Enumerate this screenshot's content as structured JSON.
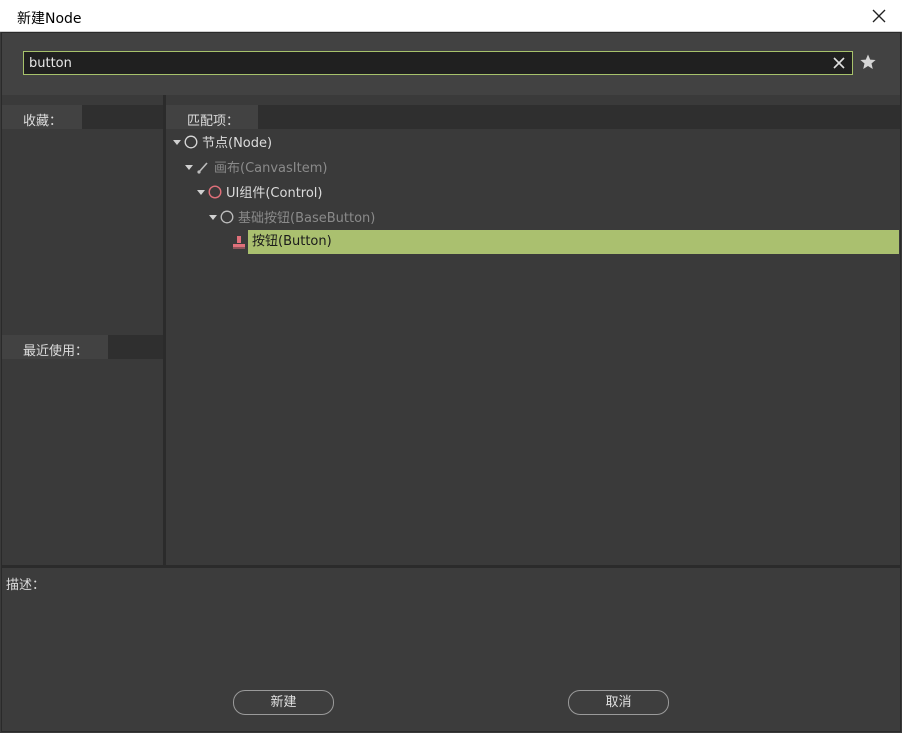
{
  "window": {
    "title": "新建Node"
  },
  "search": {
    "value": "button",
    "placeholder": ""
  },
  "favorites": {
    "tab_label": "收藏："
  },
  "recent": {
    "tab_label": "最近使用："
  },
  "matches": {
    "tab_label": "匹配项：",
    "tree": [
      {
        "label": "节点(Node)",
        "depth": 0,
        "expanded": true,
        "icon": "circle-icon",
        "style": "bright"
      },
      {
        "label": "画布(CanvasItem)",
        "depth": 1,
        "expanded": true,
        "icon": "brush-icon",
        "style": "dim"
      },
      {
        "label": "UI组件(Control)",
        "depth": 2,
        "expanded": true,
        "icon": "red-circle-icon",
        "style": "bright"
      },
      {
        "label": "基础按钮(BaseButton)",
        "depth": 3,
        "expanded": true,
        "icon": "circle-icon",
        "style": "dim"
      },
      {
        "label": "按钮(Button)",
        "depth": 4,
        "expanded": false,
        "icon": "button-node-icon",
        "style": "selected"
      }
    ]
  },
  "description": {
    "label": "描述："
  },
  "buttons": {
    "create": "新建",
    "cancel": "取消"
  },
  "colors": {
    "accent": "#aac06f",
    "background": "#424242",
    "node_red": "#e0707a"
  }
}
